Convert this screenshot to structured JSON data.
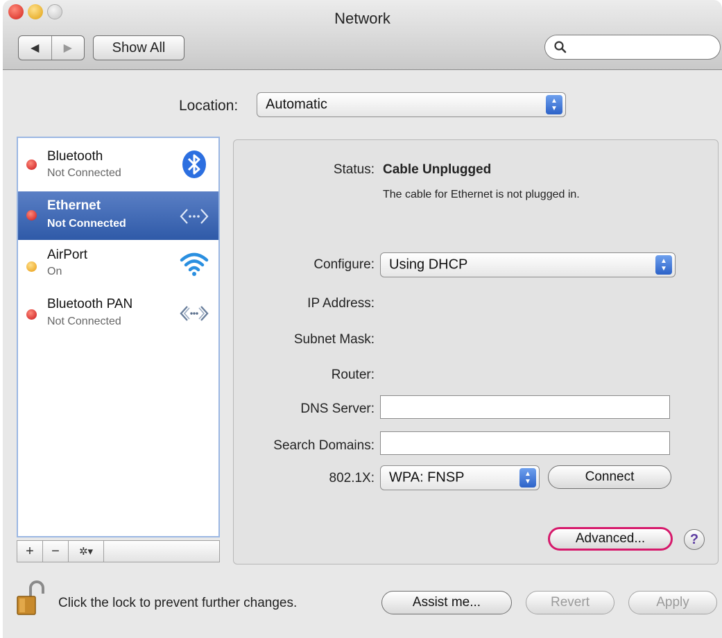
{
  "window": {
    "title": "Network"
  },
  "toolbar": {
    "back": "◀",
    "forward": "▶",
    "show_all": "Show All",
    "search_placeholder": ""
  },
  "location": {
    "label": "Location:",
    "value": "Automatic"
  },
  "services": [
    {
      "name": "Bluetooth",
      "state": "Not Connected",
      "status_color": "#d01f1f",
      "icon": "bluetooth-icon",
      "selected": false
    },
    {
      "name": "Ethernet",
      "state": "Not Connected",
      "status_color": "#d01f1f",
      "icon": "ethernet-icon",
      "selected": true
    },
    {
      "name": "AirPort",
      "state": "On",
      "status_color": "#f0a020",
      "icon": "wifi-icon",
      "selected": false
    },
    {
      "name": "Bluetooth PAN",
      "state": "Not Connected",
      "status_color": "#d01f1f",
      "icon": "bluetooth-pan-icon",
      "selected": false
    }
  ],
  "sidebar_tools": {
    "add": "+",
    "remove": "−",
    "action": "✲▾"
  },
  "detail": {
    "status_label": "Status:",
    "status_value": "Cable Unplugged",
    "status_desc": "The cable for Ethernet is not plugged in.",
    "configure_label": "Configure:",
    "configure_value": "Using DHCP",
    "ip_label": "IP Address:",
    "subnet_label": "Subnet Mask:",
    "router_label": "Router:",
    "dns_label": "DNS Server:",
    "dns_value": "",
    "search_domains_label": "Search Domains:",
    "search_domains_value": "",
    "dot1x_label": "802.1X:",
    "dot1x_value": "WPA: FNSP",
    "connect_button": "Connect",
    "advanced_button": "Advanced...",
    "help_button": "?"
  },
  "footer": {
    "lock_text": "Click the lock to prevent further changes.",
    "assist_button": "Assist me...",
    "revert_button": "Revert",
    "apply_button": "Apply"
  },
  "colors": {
    "selection": "#3b64b0",
    "highlight_ring": "#d6196b",
    "popup_arrow": "#2c62c8"
  }
}
